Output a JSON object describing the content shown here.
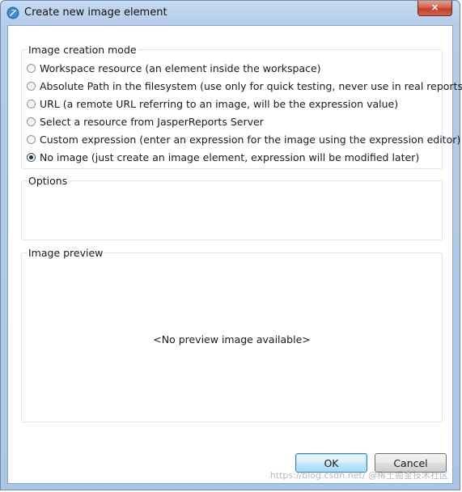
{
  "window": {
    "title": "Create new image element",
    "close_glyph": "×",
    "app_icon": "jaspersoft-studio-icon",
    "close_icon": "close-icon"
  },
  "mode_group": {
    "label": "Image creation mode",
    "options": [
      {
        "label": "Workspace resource (an element inside the workspace)",
        "checked": false
      },
      {
        "label": "Absolute Path in the filesystem (use only for quick testing, never use in real reports)",
        "checked": false
      },
      {
        "label": "URL (a remote URL referring to an image, will be the expression value)",
        "checked": false
      },
      {
        "label": "Select a resource from JasperReports Server",
        "checked": false
      },
      {
        "label": "Custom expression (enter an expression for the image using the expression editor)",
        "checked": false
      },
      {
        "label": "No image (just create an image element, expression will be modified later)",
        "checked": true
      }
    ]
  },
  "options_group": {
    "label": "Options"
  },
  "preview_group": {
    "label": "Image preview",
    "placeholder": "<No preview image available>"
  },
  "buttons": {
    "ok": "OK",
    "cancel": "Cancel"
  },
  "watermark": "https://blog.csdn.net/ @稀土掘金技术社区"
}
